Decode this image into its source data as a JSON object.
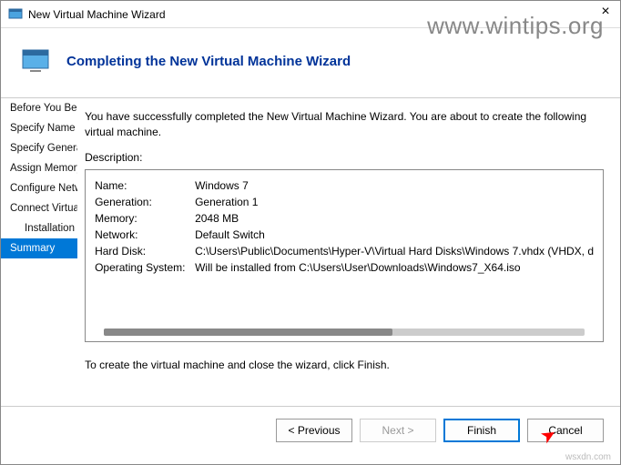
{
  "window": {
    "title": "New Virtual Machine Wizard",
    "close_glyph": "×"
  },
  "watermark": {
    "top": "www.wintips.org",
    "bottom": "wsxdn.com"
  },
  "header": {
    "title": "Completing the New Virtual Machine Wizard"
  },
  "sidebar": {
    "items": [
      {
        "label": "Before You Begin"
      },
      {
        "label": "Specify Name and Location"
      },
      {
        "label": "Specify Generation"
      },
      {
        "label": "Assign Memory"
      },
      {
        "label": "Configure Networking"
      },
      {
        "label": "Connect Virtual Hard Disk"
      },
      {
        "label": "Installation Options"
      },
      {
        "label": "Summary"
      }
    ]
  },
  "content": {
    "intro": "You have successfully completed the New Virtual Machine Wizard. You are about to create the following virtual machine.",
    "desc_label": "Description:",
    "rows": [
      {
        "key": "Name:",
        "val": "Windows 7"
      },
      {
        "key": "Generation:",
        "val": "Generation 1"
      },
      {
        "key": "Memory:",
        "val": "2048 MB"
      },
      {
        "key": "Network:",
        "val": "Default Switch"
      },
      {
        "key": "Hard Disk:",
        "val": "C:\\Users\\Public\\Documents\\Hyper-V\\Virtual Hard Disks\\Windows 7.vhdx (VHDX, d"
      },
      {
        "key": "Operating System:",
        "val": "Will be installed from C:\\Users\\User\\Downloads\\Windows7_X64.iso"
      }
    ],
    "finish_note": "To create the virtual machine and close the wizard, click Finish."
  },
  "footer": {
    "previous": "< Previous",
    "next": "Next >",
    "finish": "Finish",
    "cancel": "Cancel"
  }
}
